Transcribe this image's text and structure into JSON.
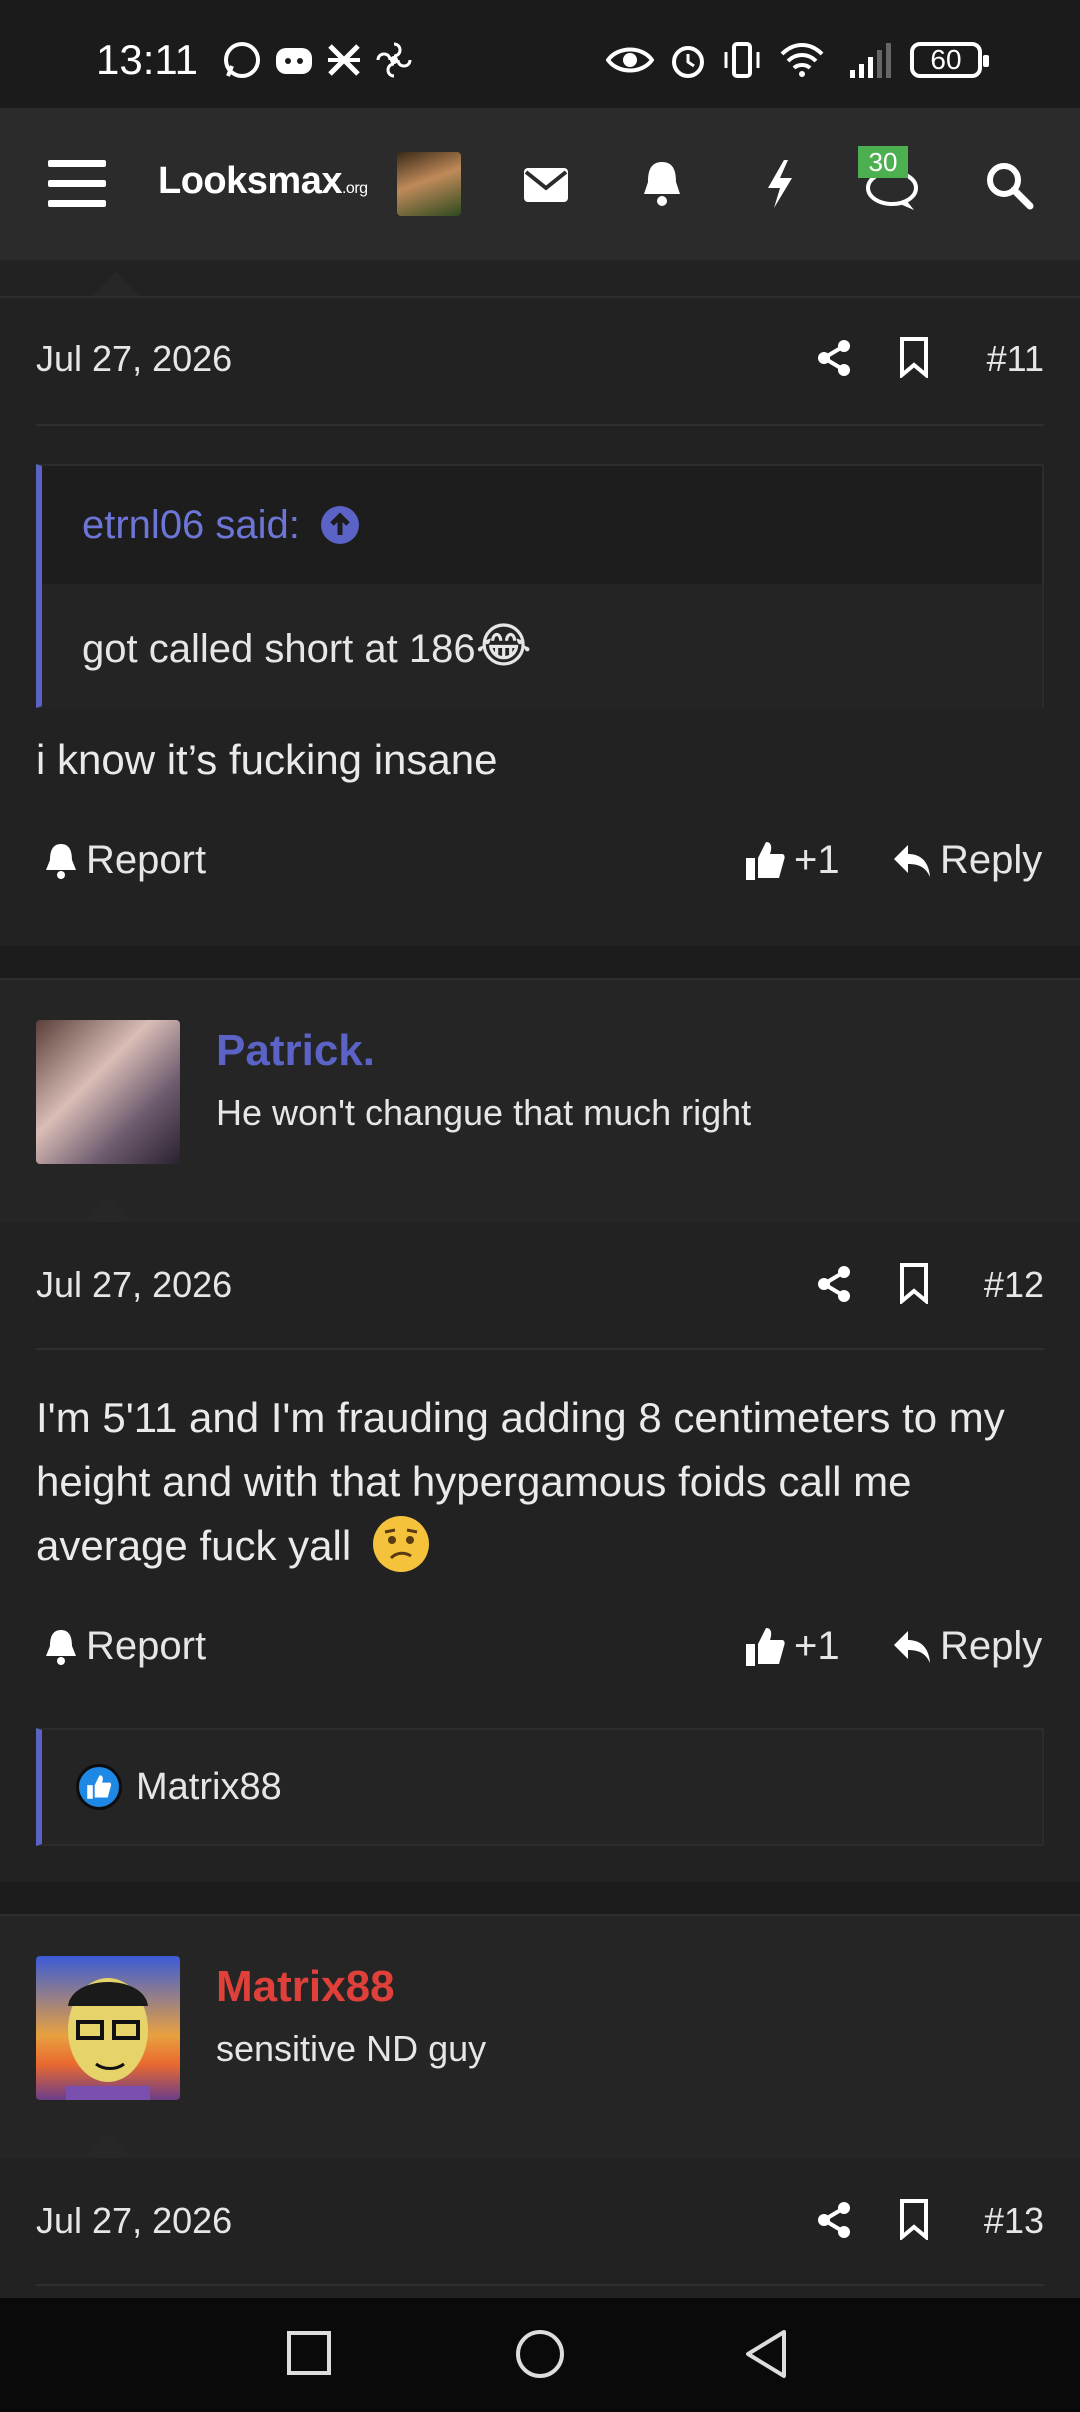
{
  "status": {
    "time": "13:11",
    "battery": "60"
  },
  "nav": {
    "logo_main": "Looksmax",
    "logo_suffix": ".org",
    "alerts_badge": "30"
  },
  "posts": [
    {
      "date": "Jul 27, 2026",
      "number": "#11",
      "quote_author": "etrnl06 said:",
      "quote_text": "got called short at 186",
      "quote_emoji": "😂",
      "text": "i know it’s fucking insane",
      "report": "Report",
      "likes": "+1",
      "reply": "Reply"
    },
    {
      "user_name": "Patrick.",
      "user_name_color": "#5b63c7",
      "user_title": "He won't changue that much right",
      "date": "Jul 27, 2026",
      "number": "#12",
      "text": "I'm 5'11 and I'm frauding adding 8 centimeters to my height and with that hypergamous foids call me average fuck yall",
      "report": "Report",
      "likes": "+1",
      "reply": "Reply",
      "reaction_user": "Matrix88"
    },
    {
      "user_name": "Matrix88",
      "user_name_color": "#e0403a",
      "user_title": "sensitive ND guy",
      "date": "Jul 27, 2026",
      "number": "#13"
    }
  ]
}
